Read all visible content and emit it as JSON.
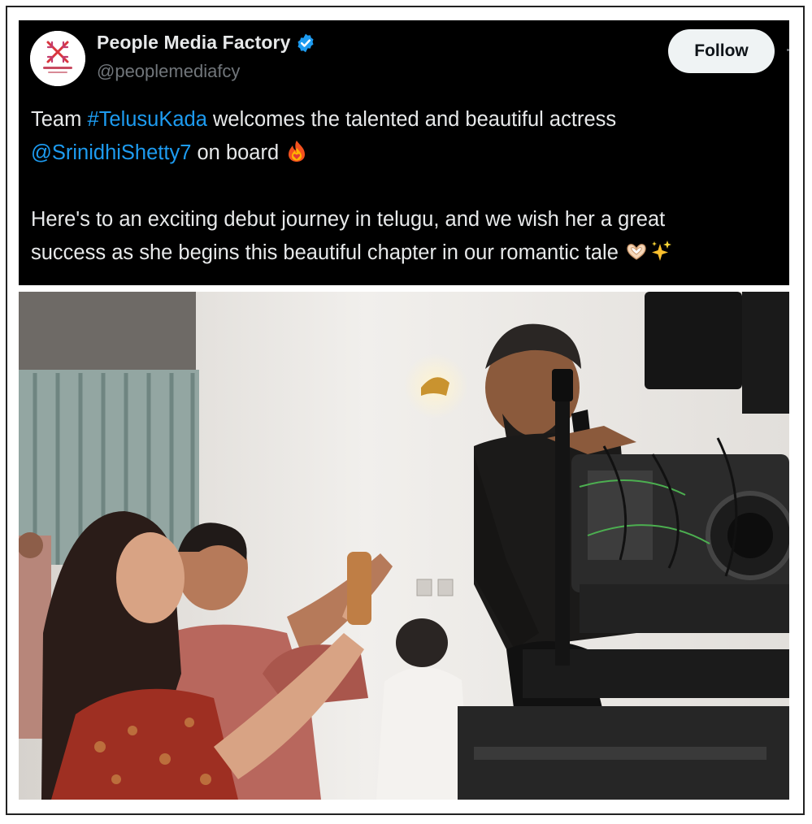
{
  "post": {
    "author": {
      "display_name": "People Media Factory",
      "handle": "@peoplemediafcy",
      "verified": true,
      "avatar_icon": "people-media-factory-logo"
    },
    "follow_label": "Follow",
    "text": {
      "line1_pre": "Team ",
      "hashtag": "#TelusuKada",
      "line1_post": " welcomes the talented and beautiful actress",
      "mention": "@SrinidhiShetty7",
      "line2_post": " on board ",
      "emoji_fire": "fire-heart-emoji",
      "line3": "Here's to an exciting debut journey in telugu, and we wish her a great",
      "line4": "success as she begins this beautiful chapter in our romantic tale ",
      "emoji_end": [
        "heart-hands-emoji",
        "sparkles-emoji"
      ]
    },
    "media": {
      "kind": "photo",
      "icon": "film-set-photo"
    }
  },
  "colors": {
    "background": "#000000",
    "text": "#e7e9ea",
    "secondary": "#71767b",
    "link": "#1d9bf0",
    "follow_bg": "#eff3f4",
    "follow_text": "#0f1419",
    "verified": "#1d9bf0"
  }
}
